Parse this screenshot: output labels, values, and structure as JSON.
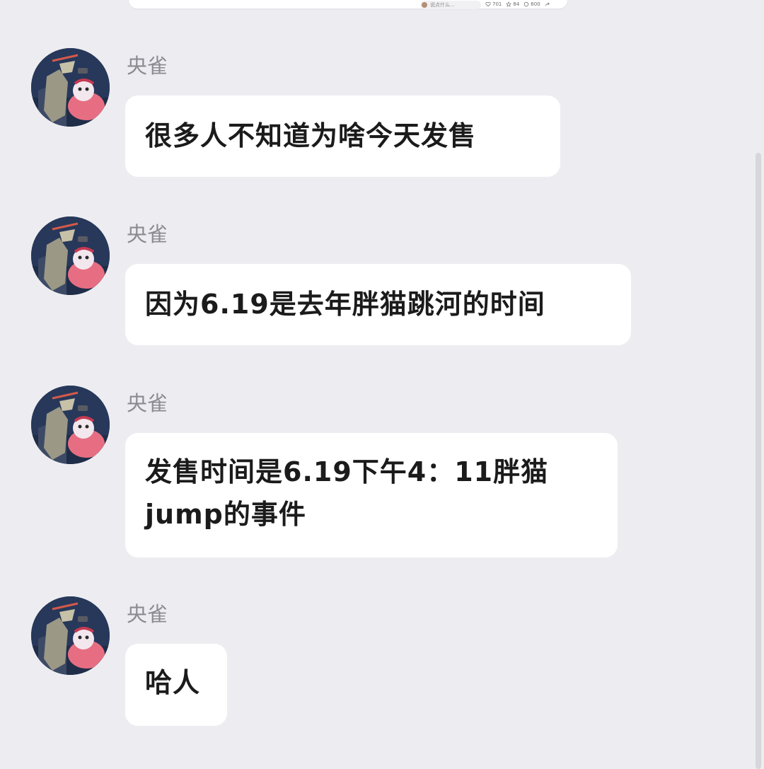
{
  "top_card": {
    "comment_placeholder": "说点什么...",
    "likes": "701",
    "stars": "84",
    "comments": "600"
  },
  "colors": {
    "page_background": "#ededf1",
    "bubble_background": "#ffffff",
    "name_text": "#8b8b91",
    "message_text": "#1b1b1b"
  },
  "messages": [
    {
      "sender": "央雀",
      "text": "很多人不知道为啥今天发售"
    },
    {
      "sender": "央雀",
      "text": "因为6.19是去年胖猫跳河的时间"
    },
    {
      "sender": "央雀",
      "text_line1": "发售时间是6.19下午4：11胖猫",
      "text_line2": "jump的事件"
    },
    {
      "sender": "央雀",
      "text": "哈人"
    }
  ],
  "icons": {
    "avatar": "avatar-anime-image-icon",
    "likes": "heart-icon",
    "stars": "star-icon",
    "comments": "comment-icon",
    "share": "share-icon"
  }
}
